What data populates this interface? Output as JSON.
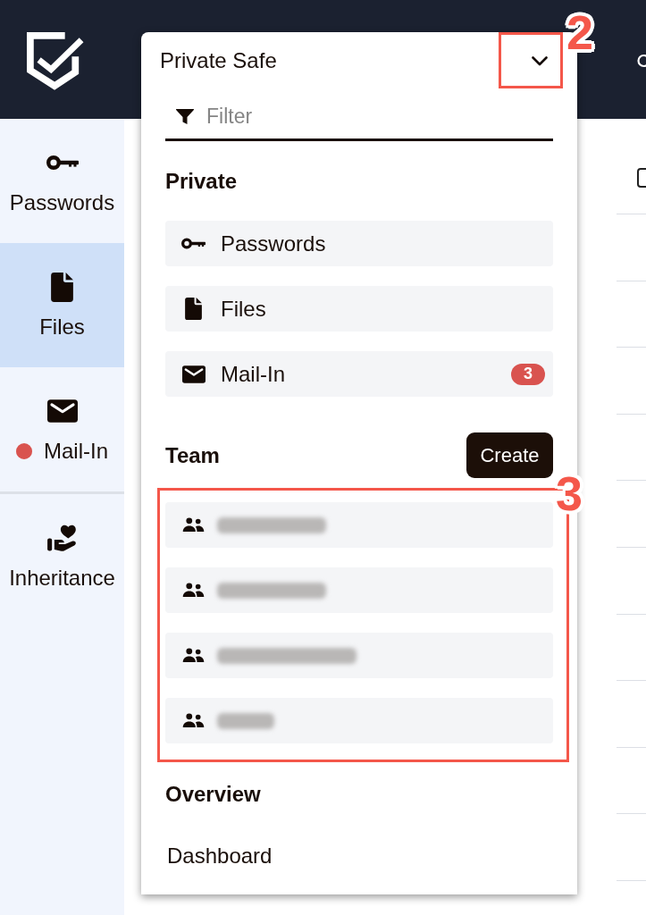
{
  "sidebar": {
    "sections": [
      {
        "items": [
          {
            "label": "Passwords",
            "kind": "key",
            "selected": false,
            "dot": false
          },
          {
            "label": "Files",
            "kind": "file",
            "selected": true,
            "dot": false
          },
          {
            "label": "Mail-In",
            "kind": "mail",
            "selected": false,
            "dot": true
          }
        ]
      },
      {
        "items": [
          {
            "label": "Inheritance",
            "kind": "care",
            "selected": false,
            "dot": false
          }
        ]
      }
    ]
  },
  "safe_menu": {
    "title": "Private Safe",
    "callout": "2",
    "filter": {
      "placeholder": "Filter"
    },
    "sections": [
      {
        "kind": "nav",
        "title": "Private",
        "items": [
          {
            "label": "Passwords",
            "kind": "key"
          },
          {
            "label": "Files",
            "kind": "file"
          },
          {
            "label": "Mail-In",
            "kind": "mail",
            "badge": "3"
          }
        ]
      },
      {
        "kind": "team",
        "title": "Team",
        "action": "Create",
        "callout": "3",
        "items": [
          {
            "kind": "medium"
          },
          {
            "kind": "medium"
          },
          {
            "kind": "long"
          },
          {
            "kind": "short"
          }
        ]
      },
      {
        "kind": "links",
        "title": "Overview",
        "items": [
          {
            "label": "Dashboard"
          }
        ]
      }
    ]
  },
  "table": {
    "select_all": {
      "checked": false
    }
  }
}
